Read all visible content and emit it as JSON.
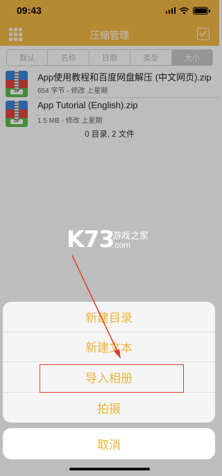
{
  "status_bar": {
    "time": "09:43"
  },
  "nav": {
    "title": "压缩管理",
    "menu_icon": "grid-icon",
    "select_icon": "check-square-icon"
  },
  "sort_tabs": [
    "默认",
    "名称",
    "日期",
    "类型",
    "大小"
  ],
  "files": [
    {
      "name": "App使用教程和百度网盘解压 (中文网页).zip",
      "meta": "654 字节 - 修改 上星期",
      "icon_tag": "ZIP"
    },
    {
      "name": "App Tutorial (English).zip",
      "meta": "1.5 MB - 修改 上星期",
      "icon_tag": "ZIP"
    }
  ],
  "summary": "0 目录, 2 文件",
  "watermark": {
    "logo": "K73",
    "cn": "游戏之家",
    "domain": ".com"
  },
  "action_sheet": {
    "items": [
      "新建目录",
      "新建文本",
      "导入相册",
      "拍摄"
    ],
    "cancel": "取消"
  },
  "colors": {
    "accent": "#f6ba45",
    "action_text": "#f0b53a",
    "annotation": "#e53a2a"
  }
}
